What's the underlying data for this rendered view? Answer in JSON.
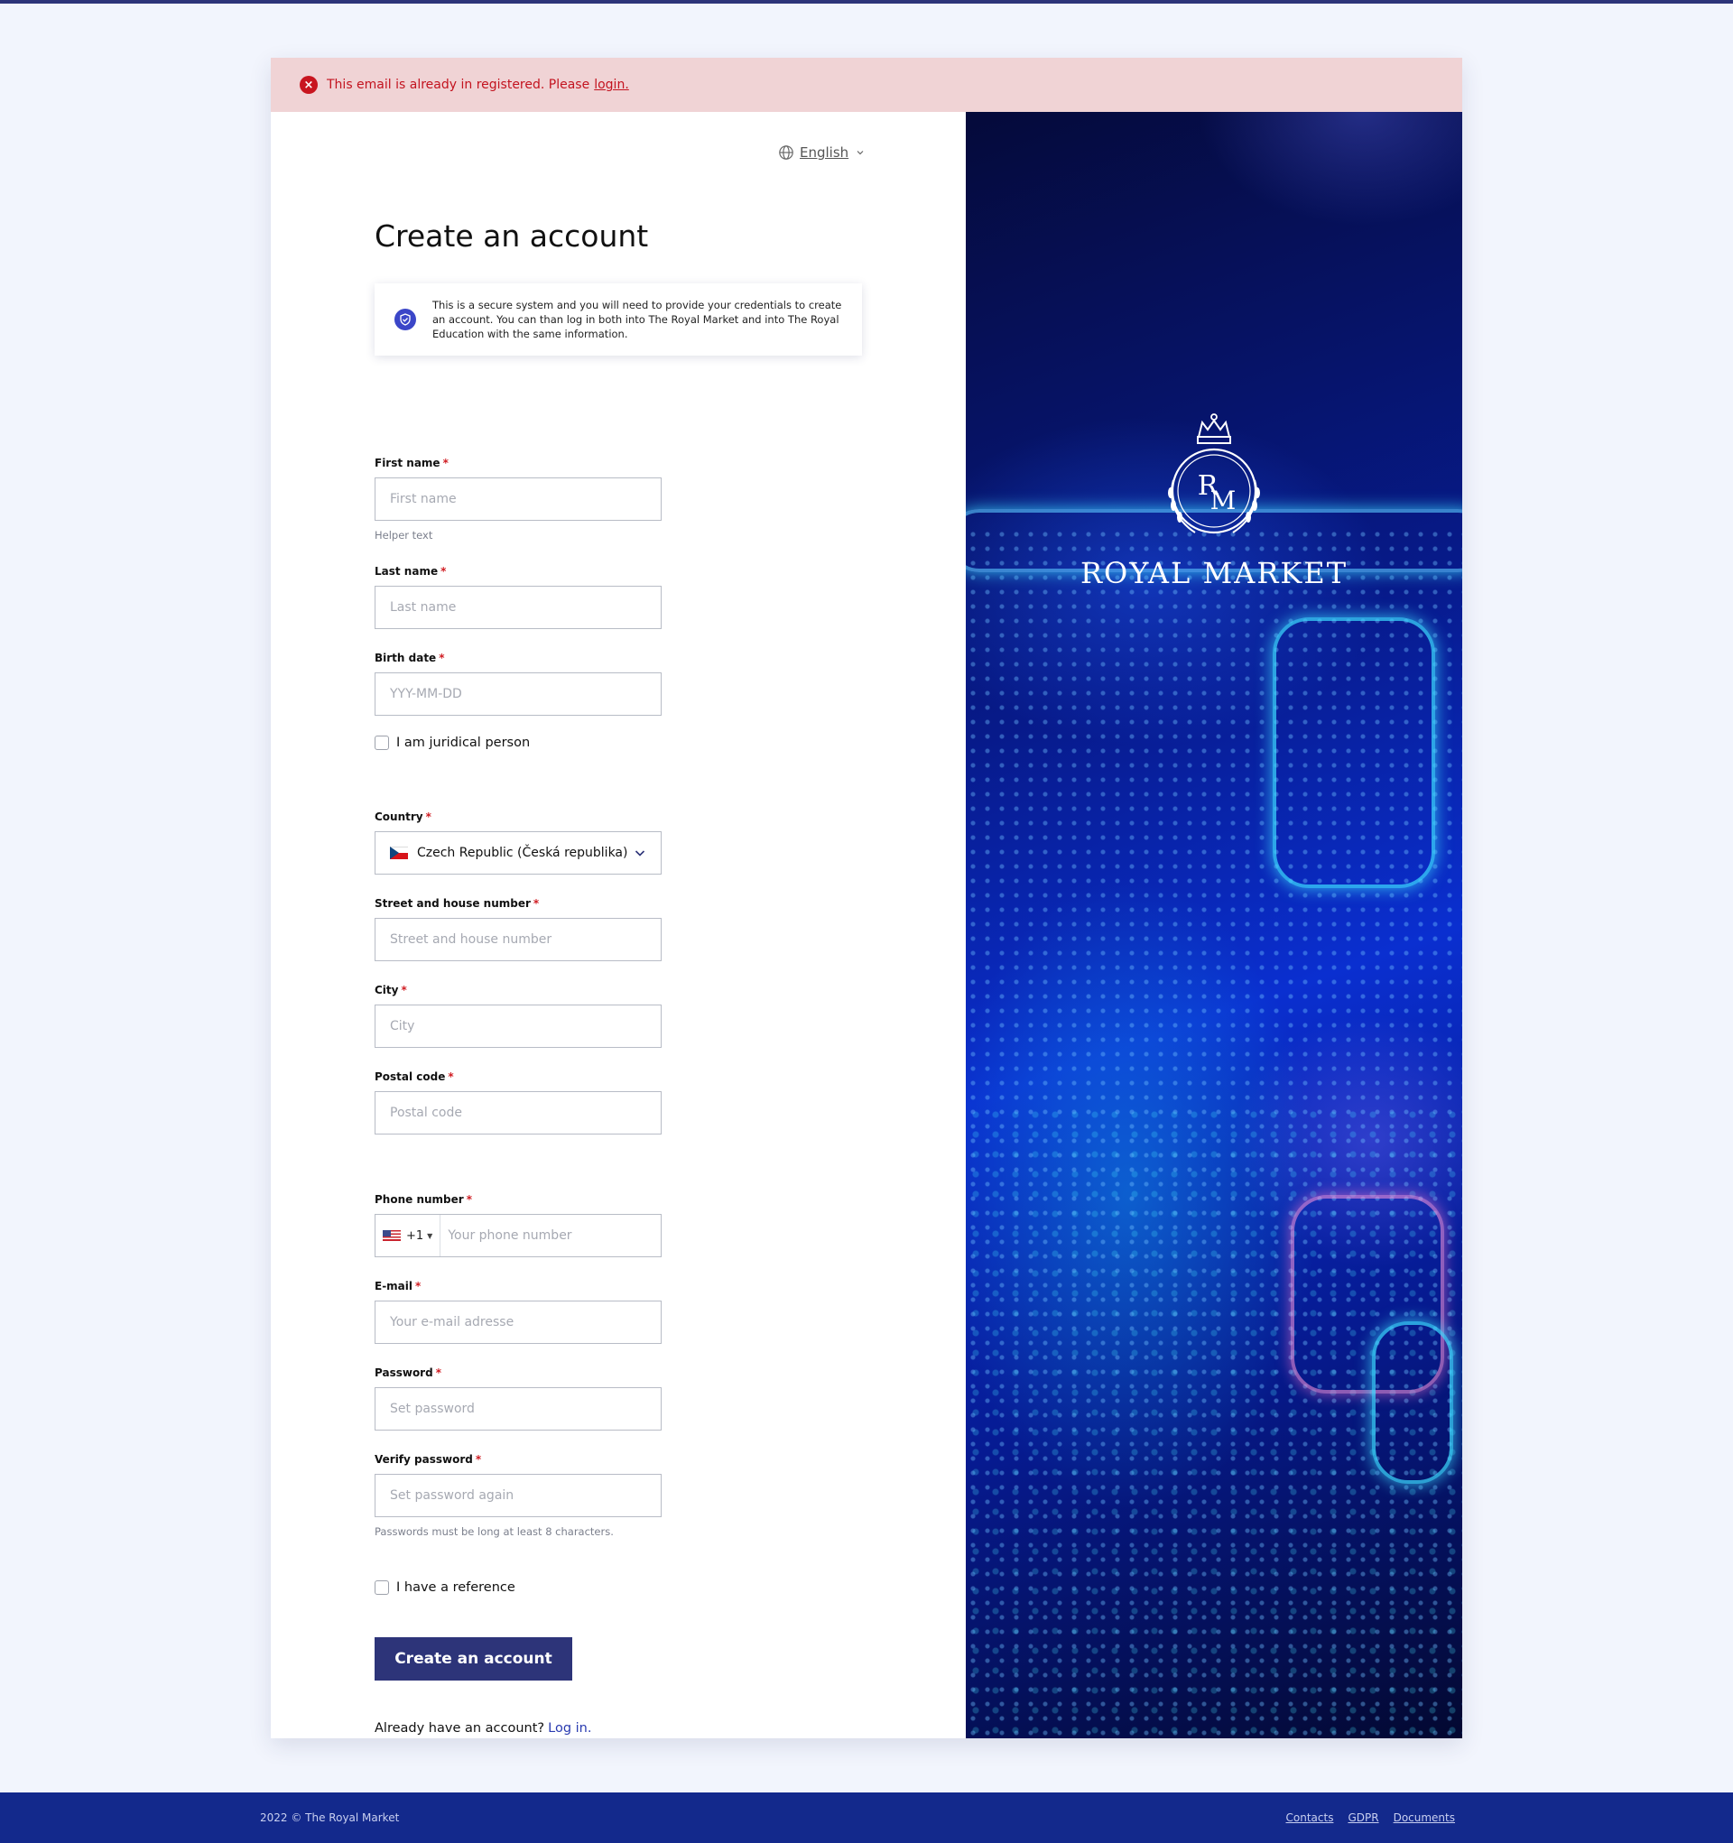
{
  "alert": {
    "message": "This email is already in registered. Please",
    "link": "login."
  },
  "language": {
    "selected": "English"
  },
  "page": {
    "title": "Create an account"
  },
  "info": {
    "text": "This is a secure system and you will need to provide your credentials to create an account. You can than log in both into The Royal Market and into The Royal Education with the same information."
  },
  "form": {
    "first_name": {
      "label": "First name",
      "placeholder": "First name",
      "helper": "Helper text"
    },
    "last_name": {
      "label": "Last name",
      "placeholder": "Last name"
    },
    "birth_date": {
      "label": "Birth date",
      "placeholder": "YYY-MM-DD"
    },
    "juridical": {
      "label": "I am juridical person"
    },
    "country": {
      "label": "Country",
      "value": "Czech Republic (Česká republika)"
    },
    "street": {
      "label": "Street and house number",
      "placeholder": "Street and house number"
    },
    "city": {
      "label": "City",
      "placeholder": "City"
    },
    "postal": {
      "label": "Postal code",
      "placeholder": "Postal code"
    },
    "phone": {
      "label": "Phone number",
      "prefix": "+1",
      "placeholder": "Your phone number"
    },
    "email": {
      "label": "E-mail",
      "placeholder": "Your e-mail adresse"
    },
    "password": {
      "label": "Password",
      "placeholder": "Set password"
    },
    "verify_password": {
      "label": "Verify password",
      "placeholder": "Set password again",
      "helper": "Passwords must be long at least 8 characters."
    },
    "reference": {
      "label": "I have a reference"
    },
    "required_mark": "*",
    "submit": "Create an account"
  },
  "login_prompt": {
    "text": "Already have an account?",
    "link": "Log in."
  },
  "brand": {
    "monogram_r": "R",
    "monogram_m": "M",
    "name": "ROYAL MARKET"
  },
  "footer": {
    "copyright": "2022 © The Royal Market",
    "links": [
      "Contacts",
      "GDPR",
      "Documents"
    ]
  },
  "colors": {
    "primary": "#2d3479",
    "footer_bg": "#13298c",
    "error": "#c3131f",
    "page_bg": "#f2f5fd"
  }
}
